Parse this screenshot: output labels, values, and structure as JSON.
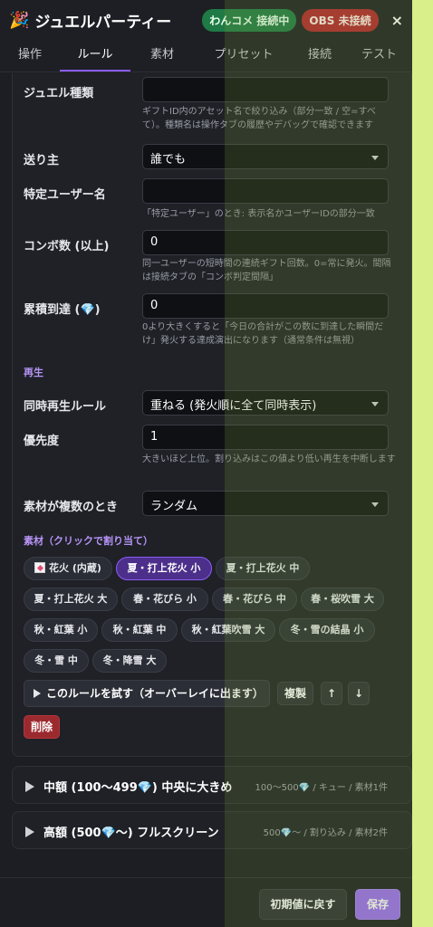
{
  "header": {
    "title": "ジュエルパーティー",
    "status_comment": "わんコメ 接続中",
    "status_obs": "OBS 未接続",
    "close": "×"
  },
  "tabs": [
    "操作",
    "ルール",
    "素材",
    "プリセット",
    "接続",
    "テスト"
  ],
  "active_tab": "ルール",
  "form": {
    "jewel_type_label": "ジュエル種類",
    "jewel_type_value": "",
    "jewel_type_hint": "ギフトID内のアセット名で絞り込み（部分一致 / 空=すべて）。種類名は操作タブの履歴やデバッグで確認できます",
    "sender_label": "送り主",
    "sender_value": "誰でも",
    "specific_user_label": "特定ユーザー名",
    "specific_user_value": "",
    "specific_user_hint": "「特定ユーザー」のとき: 表示名かユーザーIDの部分一致",
    "combo_label": "コンボ数 (以上)",
    "combo_value": "0",
    "combo_hint": "同一ユーザーの短時間の連続ギフト回数。0=常に発火。間隔は接続タブの「コンボ判定間隔」",
    "cumulative_label": "累積到達 (💎)",
    "cumulative_value": "0",
    "cumulative_hint": "0より大きくすると「今日の合計がこの数に到達した瞬間だけ」発火する達成演出になります（通常条件は無視）"
  },
  "playback": {
    "section_title": "再生",
    "simul_label": "同時再生ルール",
    "simul_value": "重ねる (発火順に全て同時表示)",
    "priority_label": "優先度",
    "priority_value": "1",
    "priority_hint": "大きいほど上位。割り込みはこの値より低い再生を中断します",
    "multi_label": "素材が複数のとき",
    "multi_value": "ランダム"
  },
  "materials": {
    "section_title": "素材（クリックで割り当て）",
    "chips": [
      {
        "label": "花火 (内蔵)",
        "selected": false,
        "icon": "firework-image-icon"
      },
      {
        "label": "夏・打上花火 小",
        "selected": true
      },
      {
        "label": "夏・打上花火 中",
        "selected": false
      },
      {
        "label": "夏・打上花火 大",
        "selected": false
      },
      {
        "label": "春・花びら 小",
        "selected": false
      },
      {
        "label": "春・花びら 中",
        "selected": false
      },
      {
        "label": "春・桜吹雪 大",
        "selected": false
      },
      {
        "label": "秋・紅葉 小",
        "selected": false
      },
      {
        "label": "秋・紅葉 中",
        "selected": false
      },
      {
        "label": "秋・紅葉吹雪 大",
        "selected": false
      },
      {
        "label": "冬・雪の結晶 小",
        "selected": false
      },
      {
        "label": "冬・雪 中",
        "selected": false
      },
      {
        "label": "冬・降雪 大",
        "selected": false
      }
    ]
  },
  "actions": {
    "try_rule": "このルールを試す（オーバーレイに出ます）",
    "duplicate": "複製",
    "up": "↑",
    "down": "↓",
    "delete": "削除"
  },
  "rules_collapsed": [
    {
      "title": "中額 (100〜499💎) 中央に大きめ",
      "meta": "100〜500💎 / キュー / 素材1件"
    },
    {
      "title": "高額 (500💎〜) フルスクリーン",
      "meta": "500💎〜 / 割り込み / 素材2件"
    }
  ],
  "footer": {
    "reset": "初期値に戻す",
    "save": "保存"
  },
  "colors": {
    "accent": "#8b5cf6",
    "connected": "#1f7a45",
    "disconnected": "#b3262d",
    "danger": "#9b2a2f"
  }
}
